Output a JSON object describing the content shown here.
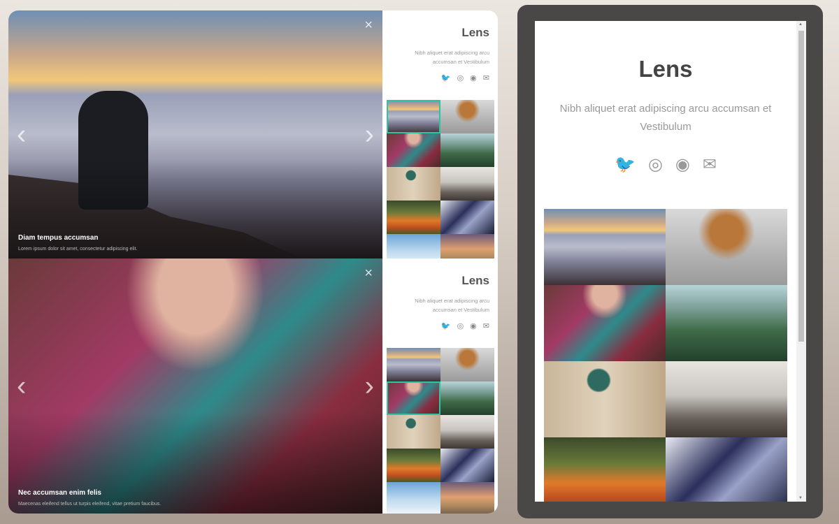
{
  "site": {
    "title": "Lens",
    "description": "Nibh aliquet erat adipiscing arcu accumsan et Vestibulum",
    "social_icons": [
      "twitter-icon",
      "instagram-icon",
      "github-icon",
      "envelope-icon"
    ]
  },
  "slides": [
    {
      "title": "Diam tempus accumsan",
      "text": "Lorem ipsum dolor sit amet, consectetur adipiscing elit."
    },
    {
      "title": "Nec accumsan enim felis",
      "text": "Maecenas eleifend tellus ut turpis eleifend, vitae pretium faucibus."
    }
  ],
  "icons": {
    "close": "×",
    "prev": "‹",
    "next": "›",
    "twitter": "🐦",
    "instagram": "◎",
    "github": "◉",
    "mail": "✉"
  },
  "accent_color": "#2ec4a0"
}
